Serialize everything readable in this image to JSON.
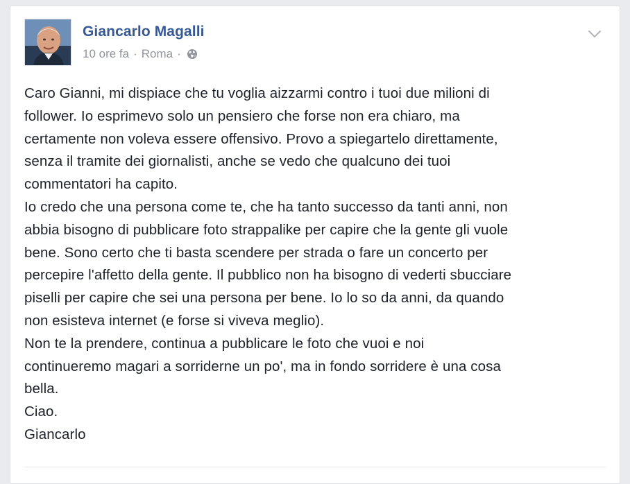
{
  "post": {
    "author": "Giancarlo Magalli",
    "time": "10 ore fa",
    "separator": "·",
    "location": "Roma",
    "privacy_icon": "globe-icon",
    "menu_icon": "chevron-down-icon",
    "lines": [
      "Caro Gianni, mi dispiace che tu voglia aizzarmi contro i tuoi due milioni di",
      "follower. Io esprimevo solo un pensiero che forse non era chiaro, ma",
      "certamente non voleva essere offensivo. Provo a spiegartelo direttamente,",
      "senza il tramite dei giornalisti, anche se vedo che qualcuno dei tuoi",
      "commentatori ha capito.",
      "Io credo che una persona come te, che ha tanto successo da tanti anni, non",
      "abbia bisogno di pubblicare foto strappalike per capire che la gente gli vuole",
      "bene. Sono certo che ti basta scendere per strada o fare un concerto per",
      "percepire l'affetto della gente. Il pubblico non ha bisogno di vederti sbucciare",
      "piselli per capire che sei una persona per bene. Io lo so da anni, da quando",
      "non esisteva internet (e forse si viveva meglio).",
      "Non te la prendere, continua a pubblicare le foto che vuoi e noi",
      "continueremo magari a sorriderne un po', ma in fondo sorridere è una cosa",
      "bella.",
      "Ciao.",
      "Giancarlo"
    ]
  },
  "colors": {
    "author_link": "#365899",
    "meta_text": "#90949c",
    "body_text": "#1d2129",
    "page_background": "#e9ebee"
  }
}
